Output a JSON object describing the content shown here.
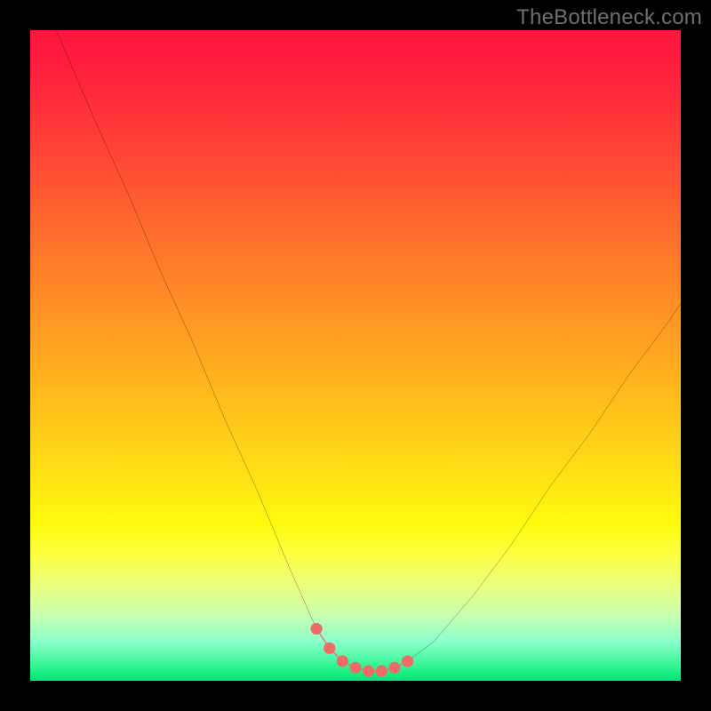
{
  "watermark": "TheBottleneck.com",
  "colors": {
    "background": "#000000",
    "gradient_top": "#ff153e",
    "gradient_bottom": "#00e477",
    "curve": "#000000",
    "highlight": "#ee6b66"
  },
  "chart_data": {
    "type": "line",
    "title": "",
    "xlabel": "",
    "ylabel": "",
    "xlim": [
      0,
      100
    ],
    "ylim": [
      0,
      100
    ],
    "annotations": [
      {
        "text": "TheBottleneck.com",
        "position": "top-right"
      }
    ],
    "series": [
      {
        "name": "bottleneck-curve",
        "x": [
          4,
          10,
          15,
          20,
          25,
          30,
          35,
          40,
          44,
          46,
          48,
          50,
          52,
          54,
          56,
          58,
          62,
          68,
          74,
          80,
          86,
          92,
          98,
          100
        ],
        "y": [
          100,
          86,
          75,
          63,
          52,
          40,
          29,
          17,
          8,
          5,
          3,
          2,
          1.5,
          1.5,
          2,
          3,
          6,
          13,
          21,
          30,
          38,
          47,
          55,
          58
        ]
      },
      {
        "name": "highlight-segment",
        "x": [
          44,
          46,
          48,
          50,
          52,
          54,
          56,
          58
        ],
        "y": [
          8,
          5,
          3,
          2,
          1.5,
          1.5,
          2,
          3
        ]
      }
    ],
    "grid": false,
    "legend": false
  }
}
